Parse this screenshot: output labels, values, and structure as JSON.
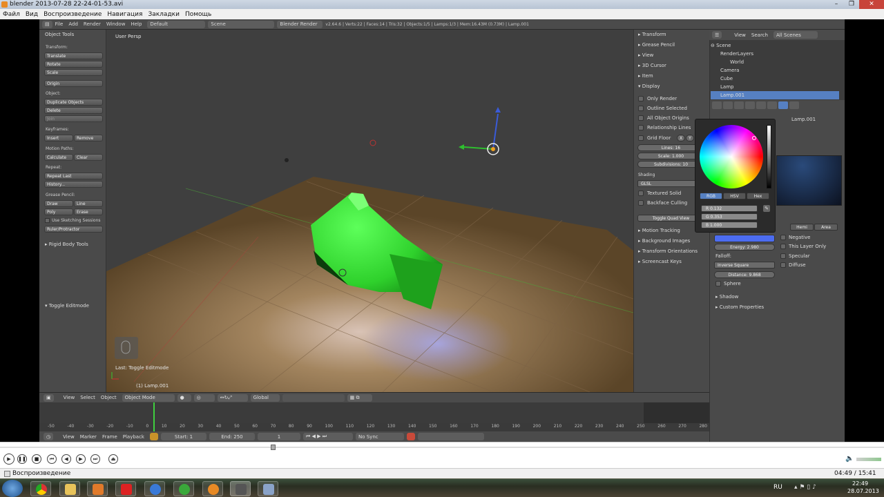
{
  "window": {
    "title": "blender 2013-07-28 22-24-01-53.avi",
    "controls": [
      "–",
      "❐",
      "✕"
    ]
  },
  "menubar": [
    "Файл",
    "Вид",
    "Воспроизведение",
    "Навигация",
    "Закладки",
    "Помощь"
  ],
  "blender_header": {
    "menus": [
      "File",
      "Add",
      "Render",
      "Window",
      "Help"
    ],
    "layout": "Default",
    "scene": "Scene",
    "engine": "Blender Render",
    "stats": "v2.64.6 | Verts:22 | Faces:14 | Tris:32 | Objects:1/5 | Lamps:1/3 | Mem:16.43M (0.73M) | Lamp.001"
  },
  "toolshelf": {
    "title": "Object Tools",
    "transform_label": "Transform:",
    "transform_buttons": [
      "Translate",
      "Rotate",
      "Scale"
    ],
    "origin": "Origin",
    "object_label": "Object:",
    "object_buttons": [
      "Duplicate Objects",
      "Delete",
      "Join"
    ],
    "keyframes_label": "Keyframes:",
    "insert": "Insert",
    "remove": "Remove",
    "motion_label": "Motion Paths:",
    "calculate": "Calculate",
    "clear": "Clear",
    "repeat_label": "Repeat:",
    "repeat_last": "Repeat Last",
    "history": "History...",
    "grease_label": "Grease Pencil:",
    "draw": "Draw",
    "line": "Line",
    "poly": "Poly",
    "erase": "Erase",
    "use_sketching": "Use Sketching Sessions",
    "ruler": "Ruler/Protractor",
    "rigid_body": "Rigid Body Tools",
    "toggle_editmode": "Toggle Editmode"
  },
  "viewport": {
    "persp_label": "User Persp",
    "last_op": "Last: Toggle Editmode",
    "object_name": "(1) Lamp.001"
  },
  "npanel": {
    "transform": "Transform",
    "grease_pencil": "Grease Pencil",
    "view": "View",
    "cursor": "3D Cursor",
    "item": "Item",
    "display": "Display",
    "only_render": "Only Render",
    "outline_selected": "Outline Selected",
    "all_origins": "All Object Origins",
    "relationship_lines": "Relationship Lines",
    "grid_floor": "Grid Floor",
    "x": "X",
    "y": "Y",
    "lines": "Lines: 16",
    "scale": "Scale: 1.000",
    "subdivisions": "Subdivisions: 10",
    "shading": "Shading",
    "shading_mode": "GLSL",
    "textured_solid": "Textured Solid",
    "backface_culling": "Backface Culling",
    "toggle_quad": "Toggle Quad View",
    "motion_tracking": "Motion Tracking",
    "background_images": "Background Images",
    "transform_orientations": "Transform Orientations",
    "screencast_keys": "Screencast Keys"
  },
  "outliner": {
    "view": "View",
    "search": "Search",
    "scope": "All Scenes",
    "rows": [
      "Scene",
      "RenderLayers",
      "World",
      "Camera",
      "Cube",
      "Lamp",
      "Lamp.001"
    ]
  },
  "properties": {
    "lamp_name": "Lamp.001",
    "types": [
      "Hemi",
      "Area"
    ],
    "negative": "Negative",
    "this_layer_only": "This Layer Only",
    "specular": "Specular",
    "diffuse": "Diffuse",
    "energy": "Energy: 2.980",
    "falloff_label": "Falloff:",
    "falloff": "Inverse Square",
    "distance": "Distance: 9.868",
    "sphere": "Sphere",
    "shadow": "Shadow",
    "custom_properties": "Custom Properties"
  },
  "color_picker": {
    "tabs": [
      "RGB",
      "HSV",
      "Hex"
    ],
    "active_tab": "RGB",
    "r": "R 0.132",
    "g": "G 0.353",
    "b": "B 1.000",
    "swatch": "#4c6cf0"
  },
  "viewport_header": {
    "menus": [
      "View",
      "Select",
      "Object"
    ],
    "mode": "Object Mode",
    "orientation": "Global"
  },
  "timeline": {
    "ticks": [
      "-50",
      "-40",
      "-30",
      "-20",
      "-10",
      "0",
      "10",
      "20",
      "30",
      "40",
      "50",
      "60",
      "70",
      "80",
      "90",
      "100",
      "110",
      "120",
      "130",
      "140",
      "150",
      "160",
      "170",
      "180",
      "190",
      "200",
      "210",
      "220",
      "230",
      "240",
      "250",
      "260",
      "270",
      "280"
    ],
    "menus": [
      "View",
      "Marker",
      "Frame",
      "Playback"
    ],
    "start": "Start: 1",
    "end": "End: 250",
    "current": "1",
    "sync": "No Sync"
  },
  "player": {
    "status": "Воспроизведение",
    "time": "04:49 / 15:41"
  },
  "taskbar": {
    "lang": "RU",
    "clock": "22:49",
    "date": "28.07.2013"
  },
  "colors": {
    "accent_select": "#5680c2",
    "cube_green": "#3fd63f"
  }
}
